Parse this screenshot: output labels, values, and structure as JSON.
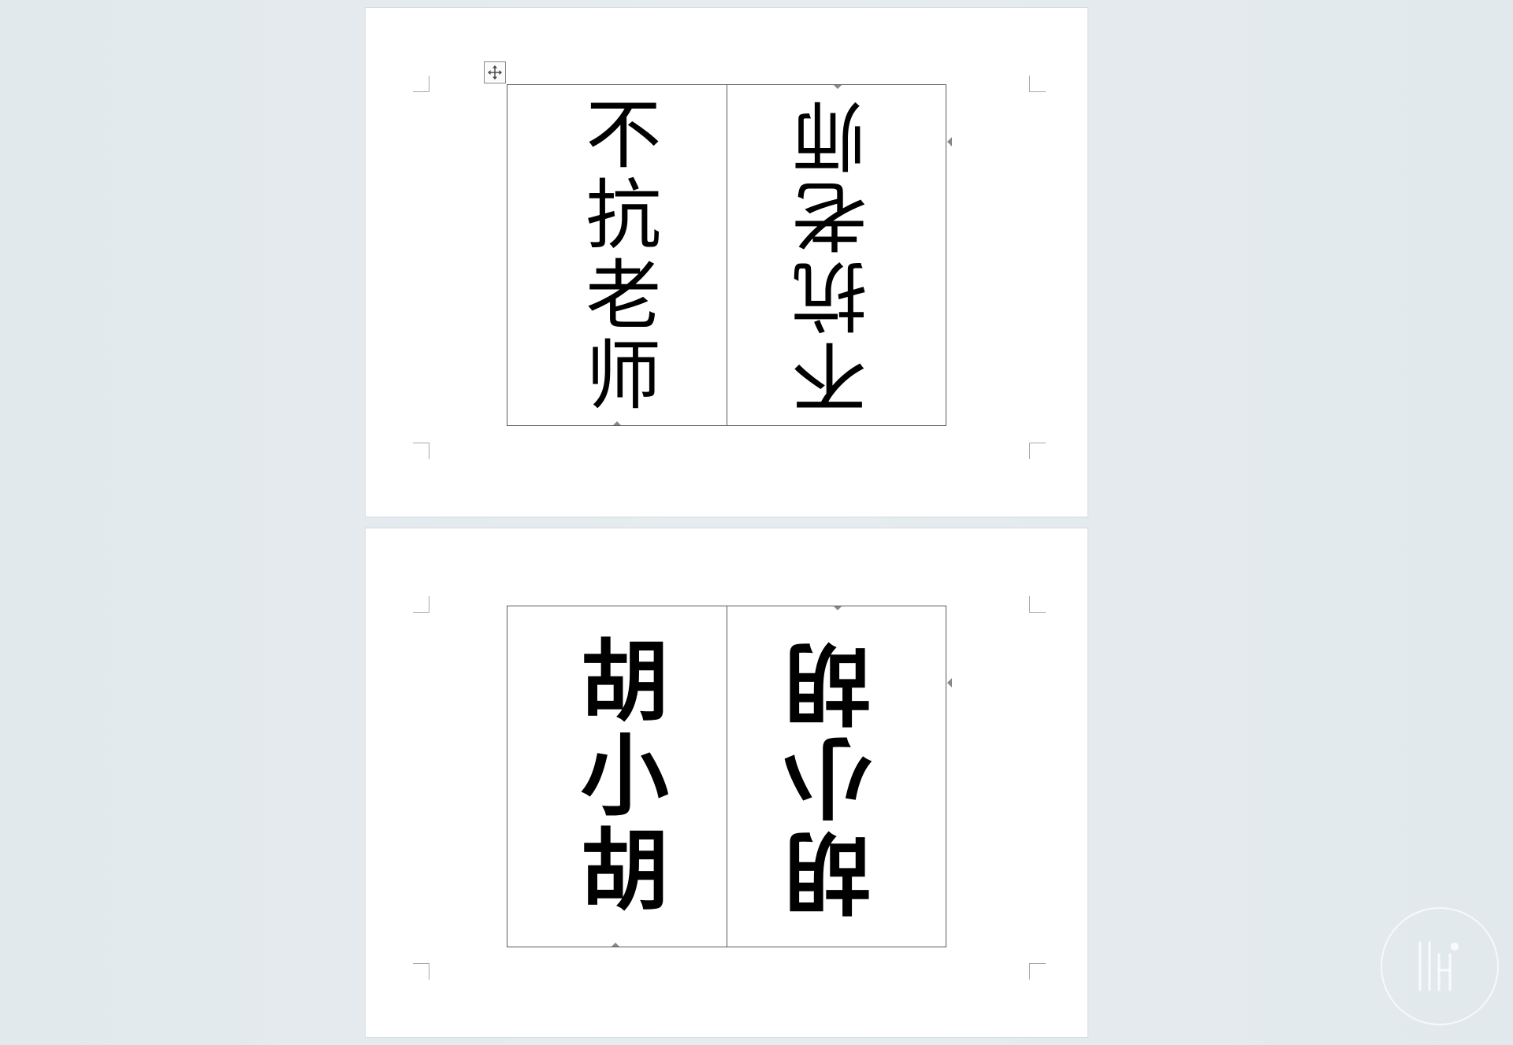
{
  "document": {
    "pages": [
      {
        "cells": [
          {
            "text": "不抗老师",
            "orientation": "upright"
          },
          {
            "text": "不抗老师",
            "orientation": "flipped"
          }
        ]
      },
      {
        "cells": [
          {
            "text": "胡小胡",
            "orientation": "upright"
          },
          {
            "text": "胡小胡",
            "orientation": "flipped"
          }
        ]
      }
    ]
  },
  "icons": {
    "table_move_handle": "move-arrows-icon",
    "watermark": "logo-watermark"
  },
  "colors": {
    "workspace_background": "#e3eaee",
    "page_background": "#ffffff",
    "table_border": "#5a5a5a",
    "text": "#000000"
  }
}
